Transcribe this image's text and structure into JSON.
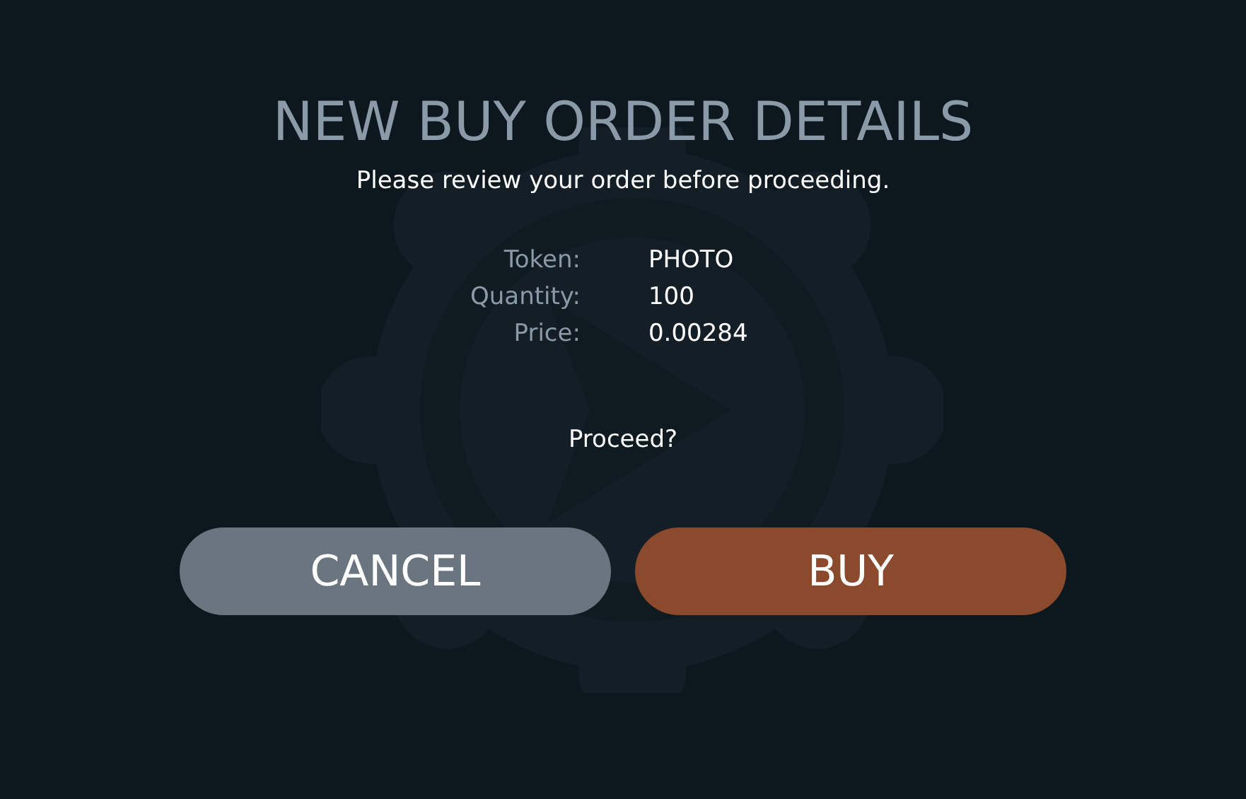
{
  "title": "NEW BUY ORDER DETAILS",
  "subtitle": "Please review your order before proceeding.",
  "details": [
    {
      "label": "Token:",
      "value": "PHOTO"
    },
    {
      "label": "Quantity:",
      "value": "100"
    },
    {
      "label": "Price:",
      "value": "0.00284"
    }
  ],
  "prompt": "Proceed?",
  "buttons": [
    {
      "label": "CANCEL",
      "kind": "cancel"
    },
    {
      "label": "BUY",
      "kind": "confirm"
    }
  ]
}
